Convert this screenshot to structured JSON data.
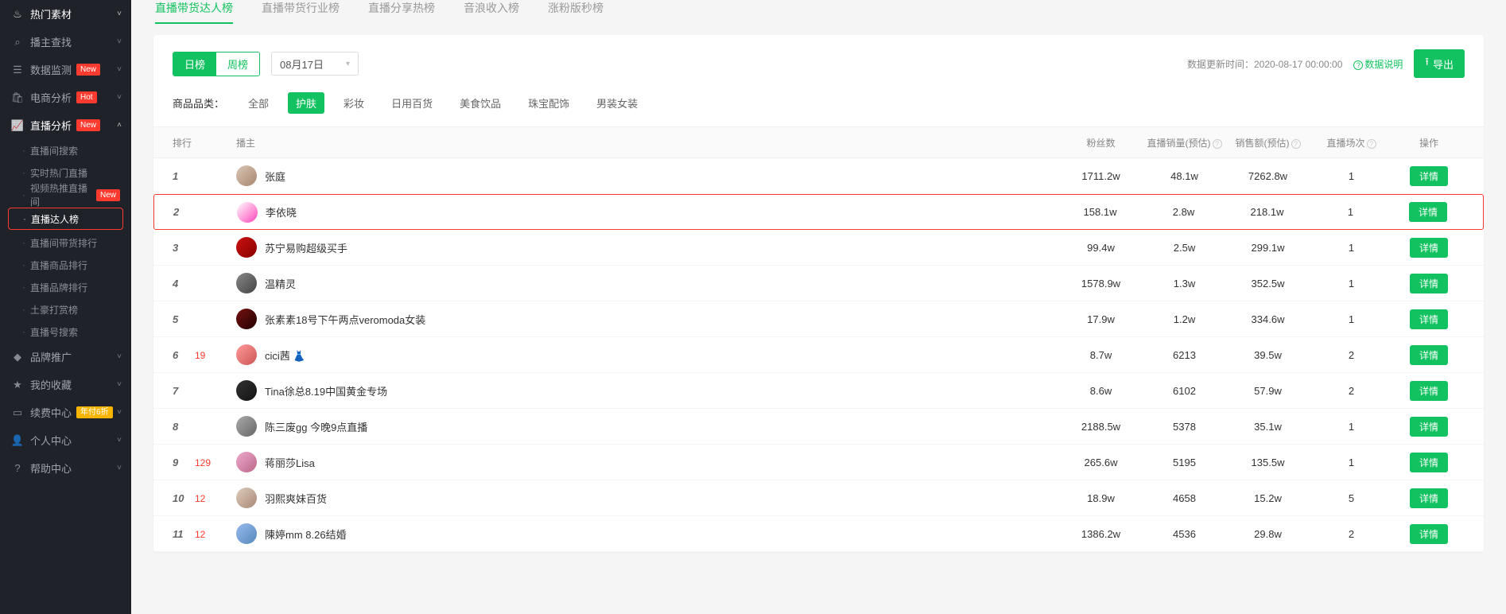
{
  "sidebar": {
    "items": [
      {
        "icon": "flame",
        "label": "热门素材"
      },
      {
        "icon": "search",
        "label": "播主查找"
      },
      {
        "icon": "database",
        "label": "数据监测",
        "badge": "New"
      },
      {
        "icon": "bag",
        "label": "电商分析",
        "badge": "Hot"
      },
      {
        "icon": "chart",
        "label": "直播分析",
        "badge": "New",
        "active": true,
        "children": [
          {
            "label": "直播间搜索"
          },
          {
            "label": "实时热门直播"
          },
          {
            "label": "视频热推直播间",
            "badge": "New"
          },
          {
            "label": "直播达人榜",
            "highlight": true
          },
          {
            "label": "直播间带货排行"
          },
          {
            "label": "直播商品排行"
          },
          {
            "label": "直播品牌排行"
          },
          {
            "label": "土豪打赏榜"
          },
          {
            "label": "直播号搜索"
          }
        ]
      },
      {
        "icon": "diamond",
        "label": "品牌推广"
      },
      {
        "icon": "star",
        "label": "我的收藏"
      },
      {
        "icon": "card",
        "label": "续费中心",
        "badge": "年付6折",
        "badgeClass": "ylw"
      },
      {
        "icon": "user",
        "label": "个人中心"
      },
      {
        "icon": "help",
        "label": "帮助中心"
      }
    ]
  },
  "topTabs": [
    {
      "label": "直播带货达人榜",
      "active": true
    },
    {
      "label": "直播带货行业榜"
    },
    {
      "label": "直播分享热榜"
    },
    {
      "label": "音浪收入榜"
    },
    {
      "label": "涨粉版秒榜"
    }
  ],
  "toolbar": {
    "seg": [
      {
        "label": "日榜",
        "active": true
      },
      {
        "label": "周榜"
      }
    ],
    "date": "08月17日",
    "updateLabel": "数据更新时间：",
    "updateTime": "2020-08-17 00:00:00",
    "explain": "数据说明",
    "export": "导出"
  },
  "filter": {
    "label": "商品品类：",
    "opts": [
      {
        "label": "全部"
      },
      {
        "label": "护肤",
        "active": true
      },
      {
        "label": "彩妆"
      },
      {
        "label": "日用百货"
      },
      {
        "label": "美食饮品"
      },
      {
        "label": "珠宝配饰"
      },
      {
        "label": "男装女装"
      }
    ]
  },
  "table": {
    "headers": {
      "rank": "排行",
      "host": "播主",
      "fans": "粉丝数",
      "sales": "直播销量(预估)",
      "amount": "销售额(预估)",
      "sessions": "直播场次",
      "act": "操作"
    },
    "detailLabel": "详情",
    "rows": [
      {
        "rank": 1,
        "delta": "",
        "name": "张庭",
        "fans": "1711.2w",
        "sales": "48.1w",
        "amount": "7262.8w",
        "sessions": "1",
        "av": "av1"
      },
      {
        "rank": 2,
        "delta": "",
        "name": "李依晓",
        "fans": "158.1w",
        "sales": "2.8w",
        "amount": "218.1w",
        "sessions": "1",
        "av": "av2",
        "hl": true
      },
      {
        "rank": 3,
        "delta": "",
        "name": "苏宁易购超级买手",
        "fans": "99.4w",
        "sales": "2.5w",
        "amount": "299.1w",
        "sessions": "1",
        "av": "av3"
      },
      {
        "rank": 4,
        "delta": "",
        "name": "温精灵",
        "fans": "1578.9w",
        "sales": "1.3w",
        "amount": "352.5w",
        "sessions": "1",
        "av": "av4"
      },
      {
        "rank": 5,
        "delta": "",
        "name": "张素素18号下午两点veromoda女装",
        "fans": "17.9w",
        "sales": "1.2w",
        "amount": "334.6w",
        "sessions": "1",
        "av": "av5"
      },
      {
        "rank": 6,
        "delta": "19",
        "name": "cici茜 👗",
        "fans": "8.7w",
        "sales": "6213",
        "amount": "39.5w",
        "sessions": "2",
        "av": "av6"
      },
      {
        "rank": 7,
        "delta": "",
        "name": "Tina徐总8.19中国黄金专场",
        "fans": "8.6w",
        "sales": "6102",
        "amount": "57.9w",
        "sessions": "2",
        "av": "av7"
      },
      {
        "rank": 8,
        "delta": "",
        "name": "陈三废gg 今晚9点直播",
        "fans": "2188.5w",
        "sales": "5378",
        "amount": "35.1w",
        "sessions": "1",
        "av": "av8"
      },
      {
        "rank": 9,
        "delta": "129",
        "name": "蒋丽莎Lisa",
        "fans": "265.6w",
        "sales": "5195",
        "amount": "135.5w",
        "sessions": "1",
        "av": "av9"
      },
      {
        "rank": 10,
        "delta": "12",
        "name": "羽熙爽妹百货",
        "fans": "18.9w",
        "sales": "4658",
        "amount": "15.2w",
        "sessions": "5",
        "av": "av10"
      },
      {
        "rank": 11,
        "delta": "12",
        "name": "陳婷mm 8.26结婚",
        "fans": "1386.2w",
        "sales": "4536",
        "amount": "29.8w",
        "sessions": "2",
        "av": "av11"
      }
    ]
  }
}
